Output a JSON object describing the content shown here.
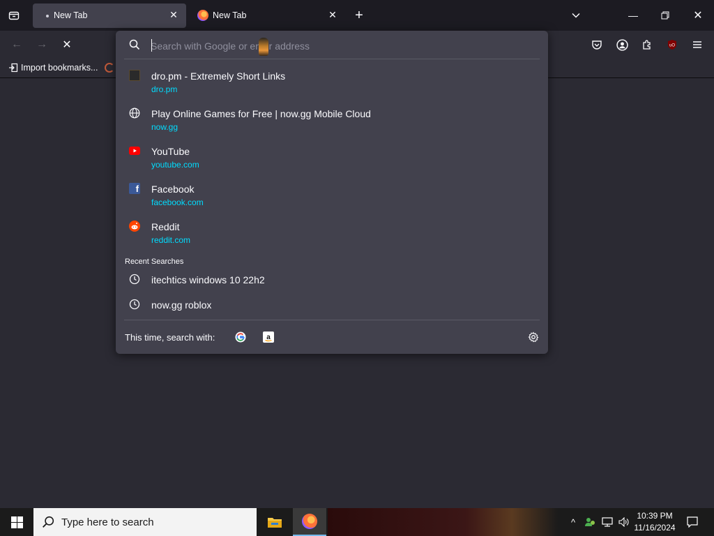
{
  "tabs": [
    {
      "label": "New Tab",
      "active": true
    },
    {
      "label": "New Tab",
      "active": false
    }
  ],
  "bookmarks": {
    "import_label": "Import bookmarks..."
  },
  "urlbar": {
    "placeholder": "Search with Google or enter address",
    "suggestions": [
      {
        "title": "dro.pm - Extremely Short Links",
        "url": "dro.pm",
        "icon": "site-favicon"
      },
      {
        "title": "Play Online Games for Free | now.gg Mobile Cloud",
        "url": "now.gg",
        "icon": "globe-icon"
      },
      {
        "title": "YouTube",
        "url": "youtube.com",
        "icon": "youtube-icon"
      },
      {
        "title": "Facebook",
        "url": "facebook.com",
        "icon": "facebook-icon"
      },
      {
        "title": "Reddit",
        "url": "reddit.com",
        "icon": "reddit-icon"
      }
    ],
    "recent_header": "Recent Searches",
    "recent": [
      {
        "text": "itechtics windows 10 22h2",
        "icon": "clock-icon"
      },
      {
        "text": "now.gg roblox",
        "icon": "clock-icon"
      }
    ],
    "search_with_label": "This time, search with:"
  },
  "taskbar": {
    "search_placeholder": "Type here to search",
    "time": "10:39 PM",
    "date": "11/16/2024"
  },
  "colors": {
    "accent_url": "#00ddff",
    "panel": "#42414d",
    "toolbar": "#2b2a33"
  }
}
